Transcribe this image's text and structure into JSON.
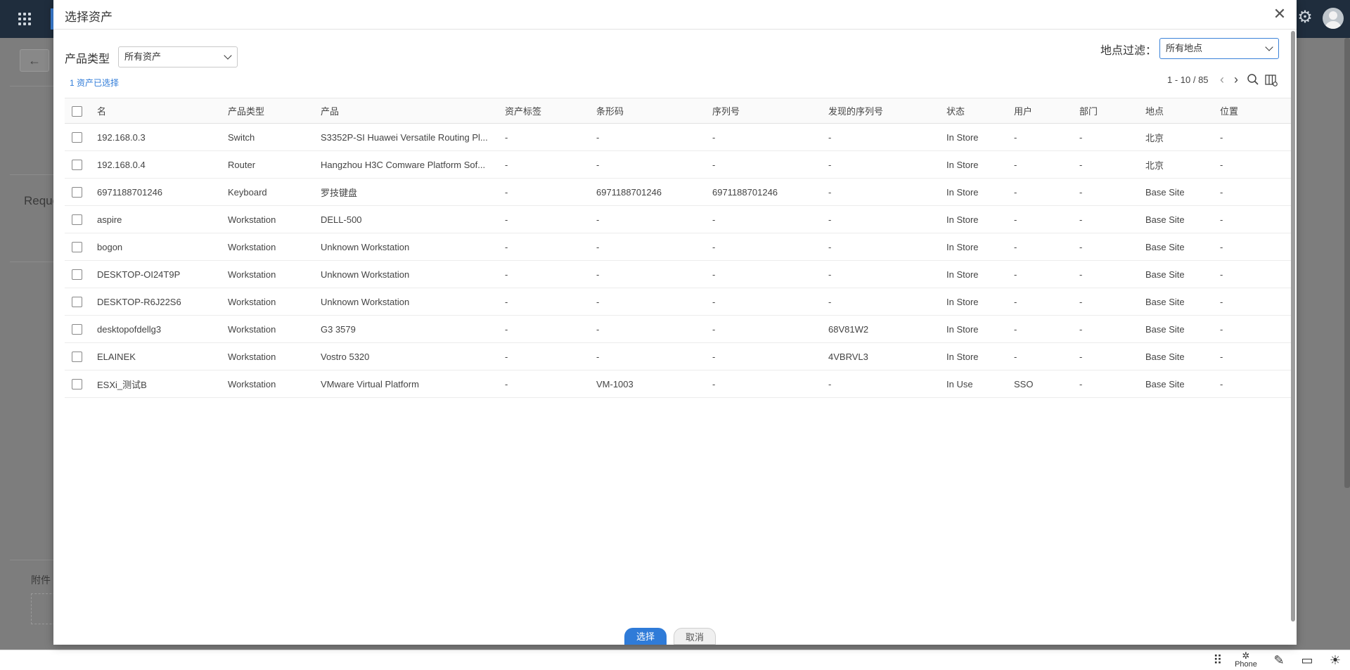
{
  "background": {
    "request_label": "Reque",
    "attachment_label": "附件"
  },
  "bottom_bar": {
    "phone_label": "Phone"
  },
  "modal": {
    "title": "选择资产",
    "product_type_label": "产品类型",
    "product_type_value": "所有资产",
    "location_filter_label": "地点过滤：",
    "location_filter_value": "所有地点",
    "selected_count_text": "1 资产已选择",
    "pagination": "1 - 10 / 85",
    "select_button": "选择",
    "cancel_button": "取消"
  },
  "table": {
    "columns": [
      "名",
      "产品类型",
      "产品",
      "资产标签",
      "条形码",
      "序列号",
      "发现的序列号",
      "状态",
      "用户",
      "部门",
      "地点",
      "位置"
    ],
    "rows": [
      [
        "192.168.0.3",
        "Switch",
        "S3352P-SI Huawei Versatile Routing Pl...",
        "-",
        "-",
        "-",
        "-",
        "In Store",
        "-",
        "-",
        "北京",
        "-"
      ],
      [
        "192.168.0.4",
        "Router",
        "Hangzhou H3C Comware Platform Sof...",
        "-",
        "-",
        "-",
        "-",
        "In Store",
        "-",
        "-",
        "北京",
        "-"
      ],
      [
        "6971188701246",
        "Keyboard",
        "罗技键盘",
        "-",
        "6971188701246",
        "6971188701246",
        "-",
        "In Store",
        "-",
        "-",
        "Base Site",
        "-"
      ],
      [
        "aspire",
        "Workstation",
        "DELL-500",
        "-",
        "-",
        "-",
        "-",
        "In Store",
        "-",
        "-",
        "Base Site",
        "-"
      ],
      [
        "bogon",
        "Workstation",
        "Unknown Workstation",
        "-",
        "-",
        "-",
        "-",
        "In Store",
        "-",
        "-",
        "Base Site",
        "-"
      ],
      [
        "DESKTOP-OI24T9P",
        "Workstation",
        "Unknown Workstation",
        "-",
        "-",
        "-",
        "-",
        "In Store",
        "-",
        "-",
        "Base Site",
        "-"
      ],
      [
        "DESKTOP-R6J22S6",
        "Workstation",
        "Unknown Workstation",
        "-",
        "-",
        "-",
        "-",
        "In Store",
        "-",
        "-",
        "Base Site",
        "-"
      ],
      [
        "desktopofdellg3",
        "Workstation",
        "G3 3579",
        "-",
        "-",
        "-",
        "68V81W2",
        "In Store",
        "-",
        "-",
        "Base Site",
        "-"
      ],
      [
        "ELAINEK",
        "Workstation",
        "Vostro 5320",
        "-",
        "-",
        "-",
        "4VBRVL3",
        "In Store",
        "-",
        "-",
        "Base Site",
        "-"
      ],
      [
        "ESXi_测试B",
        "Workstation",
        "VMware Virtual Platform",
        "-",
        "VM-1003",
        "-",
        "-",
        "In Use",
        "SSO",
        "-",
        "Base Site",
        "-"
      ]
    ]
  },
  "colors": {
    "accent": "#2f7bd8",
    "topbar": "#1f2d3d"
  }
}
